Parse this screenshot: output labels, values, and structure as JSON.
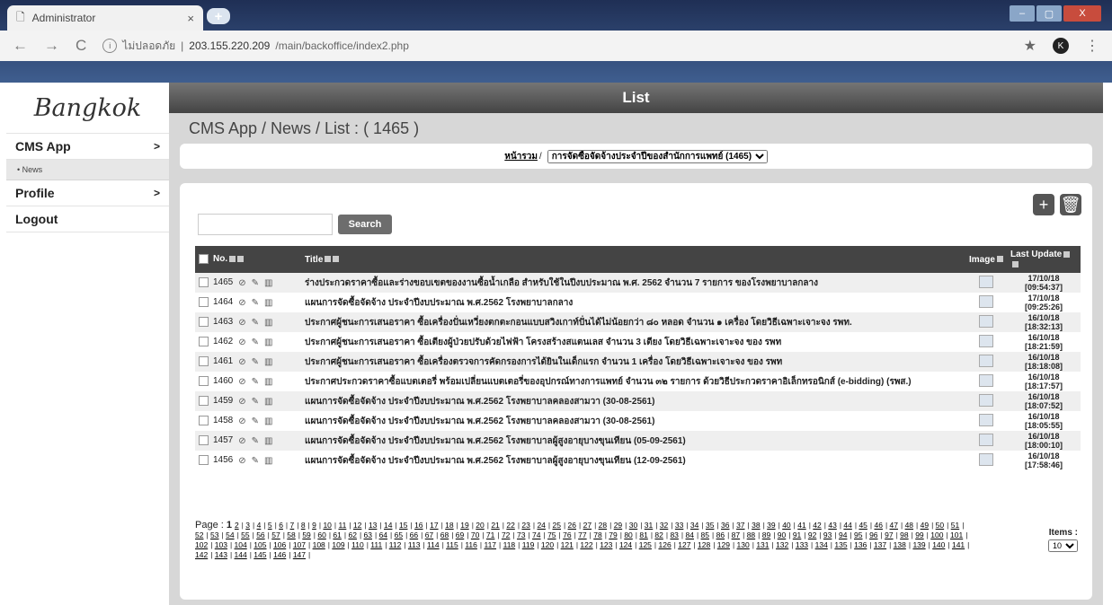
{
  "browser": {
    "tab_title": "Administrator",
    "tab_close": "×",
    "newtab": "+",
    "window_buttons": [
      "–",
      "▢",
      "X"
    ],
    "security_label": "ไม่ปลอดภัย",
    "url_host": "203.155.220.209",
    "url_path": "/main/backoffice/index2.php",
    "profile_initial": "K"
  },
  "sidebar": {
    "brand": "Bangkok",
    "items": [
      {
        "label": "CMS App",
        "arrow": ">"
      },
      {
        "label": "• News"
      },
      {
        "label": "Profile",
        "arrow": ">"
      },
      {
        "label": "Logout"
      }
    ]
  },
  "main": {
    "title": "List",
    "heading": "CMS App / News / List : ( 1465 )",
    "filter_home": "หน้ารวม",
    "filter_sep": "/",
    "filter_selected": "การจัดซื้อจัดจ้างประจำปีของสำนักการแพทย์ (1465)",
    "search_button": "Search",
    "search_placeholder": ""
  },
  "table": {
    "columns": {
      "no": "No.",
      "title": "Title",
      "image": "Image",
      "last_update": "Last Update"
    },
    "rows": [
      {
        "no": "1465",
        "title": "ร่างประกวดราคาซื้อและร่างขอบเขตของงานซื้อน้ำเกลือ สำหรับใช้ในปีงบประมาณ พ.ศ. 2562 จำนวน 7 รายการ ของโรงพยาบาลกลาง",
        "date": "17/10/18",
        "time": "[09:54:37]"
      },
      {
        "no": "1464",
        "title": "แผนการจัดซื้อจัดจ้าง ประจำปีงบประมาณ พ.ศ.2562 โรงพยาบาลกลาง",
        "date": "17/10/18",
        "time": "[09:25:26]"
      },
      {
        "no": "1463",
        "title": "ประกาศผู้ชนะการเสนอราคา ซื้อเครื่องปั่นเหวี่ยงตกตะกอนแบบสวิงเกาท์ปั่นได้ไม่น้อยกว่า ๘๐ หลอด จำนวน ๑ เครื่อง โดยวิธีเฉพาะเจาะจง รพท.",
        "date": "16/10/18",
        "time": "[18:32:13]"
      },
      {
        "no": "1462",
        "title": "ประกาศผู้ชนะการเสนอราคา ซื้อเตียงผู้ป่วยปรับด้วยไฟฟ้า โครงสร้างสแตนเลส จำนวน 3 เตียง โดยวิธีเฉพาะเจาะจง ของ รพท",
        "date": "16/10/18",
        "time": "[18:21:59]"
      },
      {
        "no": "1461",
        "title": "ประกาศผู้ชนะการเสนอราคา ซื้อเครื่องตรวจการคัดกรองการได้ยินในเด็กแรก จำนวน 1 เครื่อง โดยวิธีเฉพาะเจาะจง ของ รพท",
        "date": "16/10/18",
        "time": "[18:18:08]"
      },
      {
        "no": "1460",
        "title": "ประกาศประกวดราคาซื้อแบตเตอรี่ พร้อมเปลี่ยนแบตเตอรี่ของอุปกรณ์ทางการแพทย์ จำนวน ๓๒ รายการ ด้วยวิธีประกวดราคาอิเล็กทรอนิกส์ (e-bidding) (รพส.)",
        "date": "16/10/18",
        "time": "[18:17:57]"
      },
      {
        "no": "1459",
        "title": "แผนการจัดซื้อจัดจ้าง ประจำปีงบประมาณ พ.ศ.2562 โรงพยาบาลคลองสามวา (30-08-2561)",
        "date": "16/10/18",
        "time": "[18:07:52]"
      },
      {
        "no": "1458",
        "title": "แผนการจัดซื้อจัดจ้าง ประจำปีงบประมาณ พ.ศ.2562 โรงพยาบาลคลองสามวา (30-08-2561)",
        "date": "16/10/18",
        "time": "[18:05:55]"
      },
      {
        "no": "1457",
        "title": "แผนการจัดซื้อจัดจ้าง ประจำปีงบประมาณ พ.ศ.2562 โรงพยาบาลผู้สูงอายุบางขุนเทียน (05-09-2561)",
        "date": "16/10/18",
        "time": "[18:00:10]"
      },
      {
        "no": "1456",
        "title": "แผนการจัดซื้อจัดจ้าง ประจำปีงบประมาณ พ.ศ.2562 โรงพยาบาลผู้สูงอายุบางขุนเทียน (12-09-2561)",
        "date": "16/10/18",
        "time": "[17:58:46]"
      }
    ]
  },
  "pager": {
    "label": "Page :",
    "current": "1",
    "last_page": 147,
    "items_label": "Items :",
    "items_value": "10"
  }
}
